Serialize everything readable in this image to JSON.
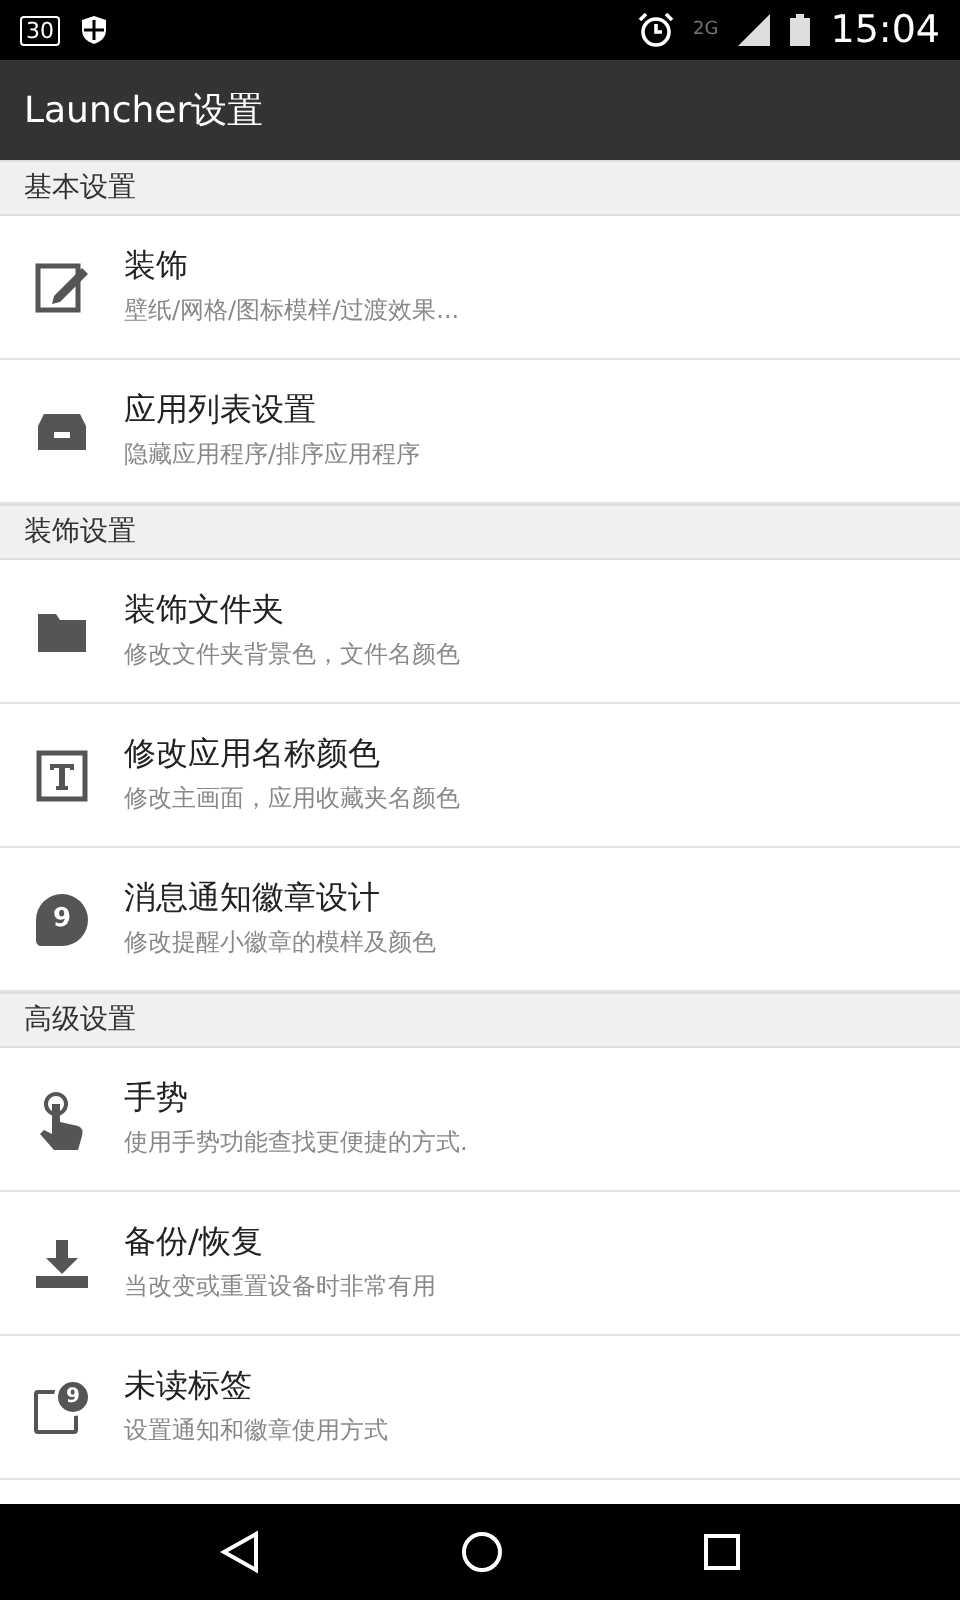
{
  "status_bar": {
    "calendar_day": "30",
    "network": "2G",
    "time": "15:04"
  },
  "toolbar": {
    "title": "Launcher设置"
  },
  "sections": [
    {
      "title": "基本设置",
      "items": [
        {
          "kind": "edit",
          "title": "装饰",
          "subtitle": "壁纸/网格/图标模样/过渡效果..."
        },
        {
          "kind": "drawer",
          "title": "应用列表设置",
          "subtitle": "隐藏应用程序/排序应用程序"
        }
      ]
    },
    {
      "title": "装饰设置",
      "items": [
        {
          "kind": "folder",
          "title": "装饰文件夹",
          "subtitle": "修改文件夹背景色，文件名颜色"
        },
        {
          "kind": "text",
          "title": "修改应用名称颜色",
          "subtitle": "修改主画面，应用收藏夹名颜色"
        },
        {
          "kind": "bubble",
          "badge": "9",
          "title": "消息通知徽章设计",
          "subtitle": "修改提醒小徽章的模样及颜色"
        }
      ]
    },
    {
      "title": "高级设置",
      "items": [
        {
          "kind": "touch",
          "title": "手势",
          "subtitle": "使用手势功能查找更便捷的方式."
        },
        {
          "kind": "download",
          "title": "备份/恢复",
          "subtitle": "当改变或重置设备时非常有用"
        },
        {
          "kind": "unread",
          "badge": "9",
          "title": "未读标签",
          "subtitle": "设置通知和徽章使用方式"
        }
      ]
    }
  ]
}
